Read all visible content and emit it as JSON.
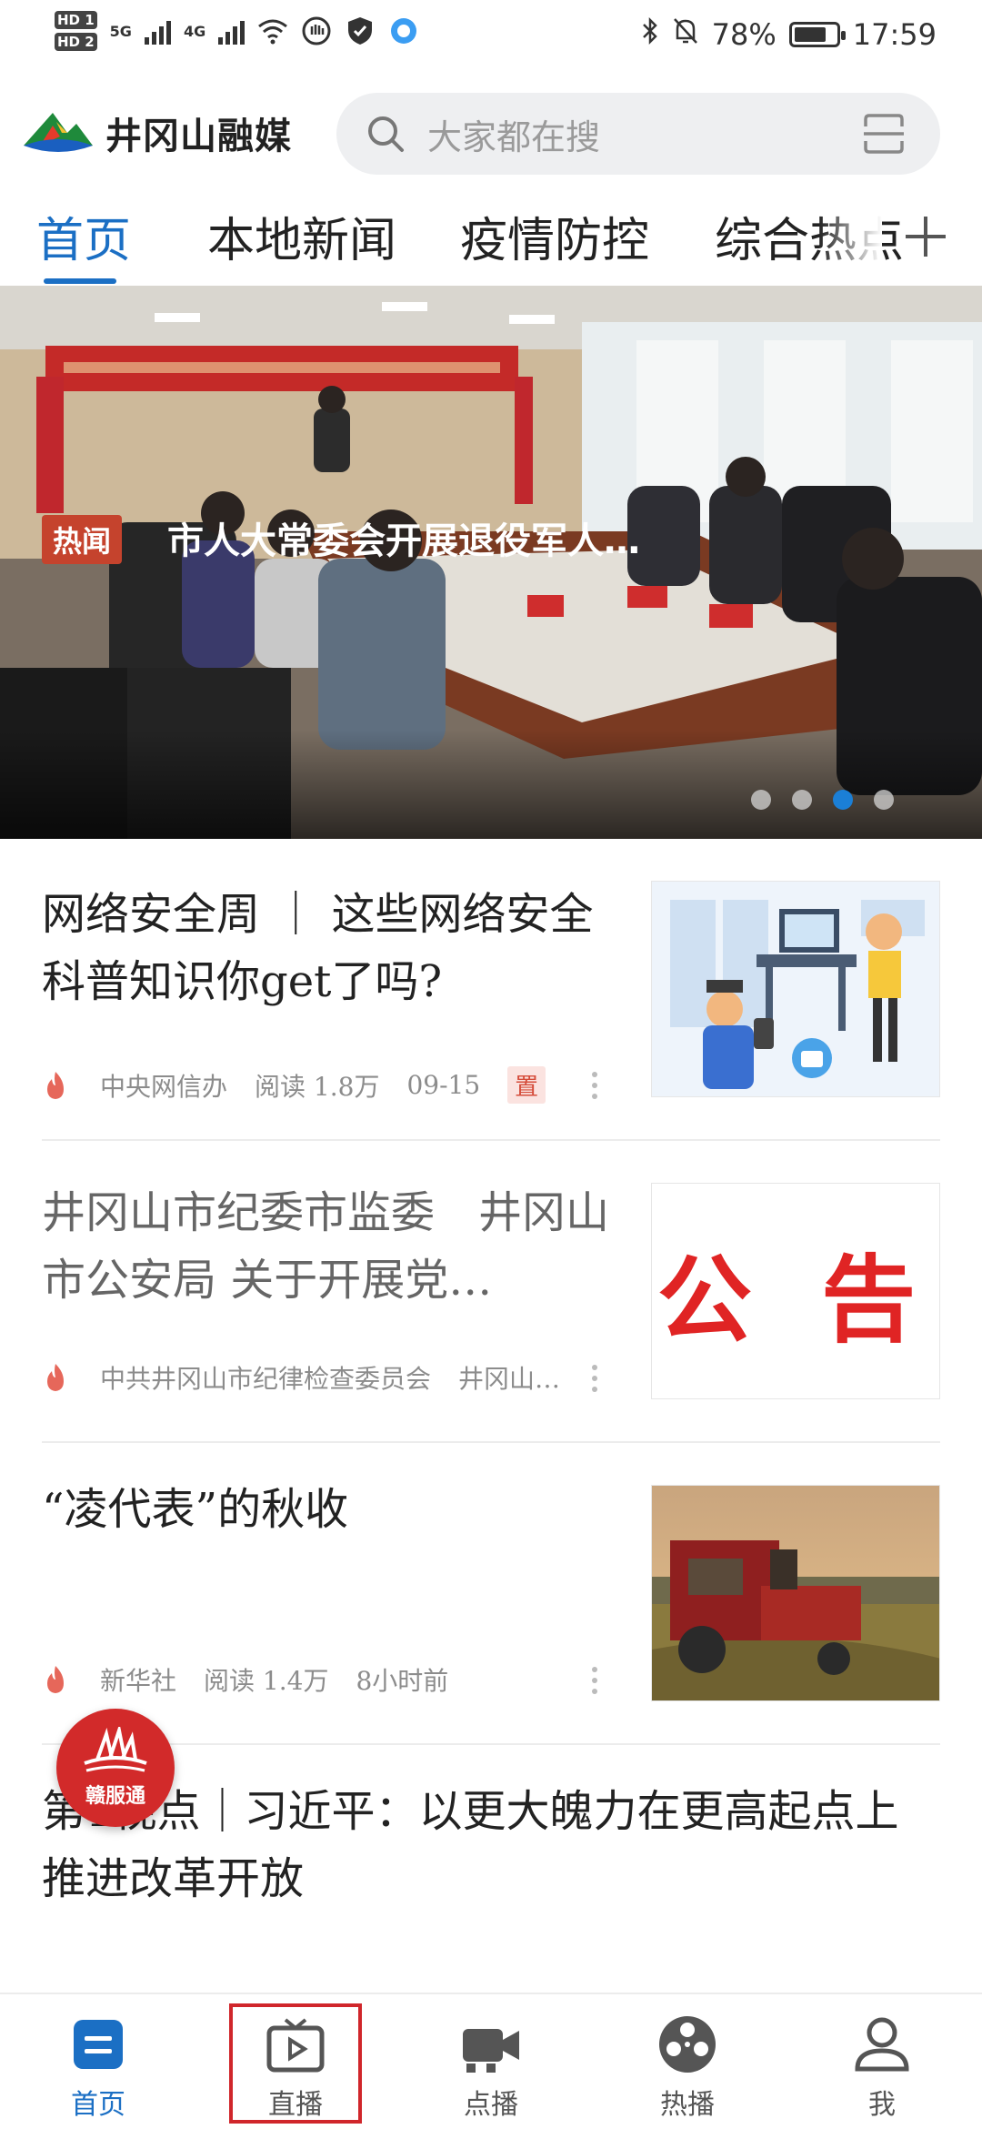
{
  "status_bar": {
    "hd1": "HD 1",
    "hd2": "HD 2",
    "net1": "5G",
    "net2": "4G",
    "battery_pct": "78%",
    "battery_level": 0.78,
    "time": "17:59",
    "icons": [
      "signal-icon",
      "wifi-icon",
      "hand-icon",
      "shield-icon",
      "browser-icon",
      "bluetooth-icon",
      "bell-off-icon",
      "battery-icon"
    ]
  },
  "header": {
    "app_name": "井冈山融媒",
    "search_placeholder": "大家都在搜"
  },
  "tabs": [
    {
      "label": "首页",
      "active": true
    },
    {
      "label": "本地新闻",
      "active": false
    },
    {
      "label": "疫情防控",
      "active": false
    },
    {
      "label": "综合热点",
      "active": false
    }
  ],
  "banner": {
    "badge": "热闻",
    "title": "市人大常委会开展退役军人…",
    "slide_count": 4,
    "active_slide": 3
  },
  "articles": [
    {
      "title": "网络安全周 ｜ 这些网络安全科普知识你get了吗?",
      "source": "中央网信办",
      "reads": "阅读 1.8万",
      "time": "09-15",
      "pinned_label": "置"
    },
    {
      "title": "井冈山市纪委市监委　井冈山市公安局 关于开展党…",
      "source": "中共井冈山市纪律检查委员会",
      "extra": "井冈山…",
      "thumb_text": "公 告"
    },
    {
      "title": "“凌代表”的秋收",
      "source": "新华社",
      "reads": "阅读 1.4万",
      "time": "8小时前"
    },
    {
      "title": "第1视点｜习近平：以更大魄力在更高起点上推进改革开放"
    }
  ],
  "float_badge": {
    "label": "赣服通"
  },
  "bottom_nav": [
    {
      "label": "首页",
      "icon": "home-icon",
      "active": true
    },
    {
      "label": "直播",
      "icon": "live-tv-icon",
      "active": false
    },
    {
      "label": "点播",
      "icon": "video-camera-icon",
      "active": false
    },
    {
      "label": "热播",
      "icon": "film-reel-icon",
      "active": false
    },
    {
      "label": "我",
      "icon": "user-icon",
      "active": false
    }
  ],
  "colors": {
    "accent": "#1b6fc4",
    "hot_badge": "#c5432d",
    "highlight": "#d0262b"
  }
}
